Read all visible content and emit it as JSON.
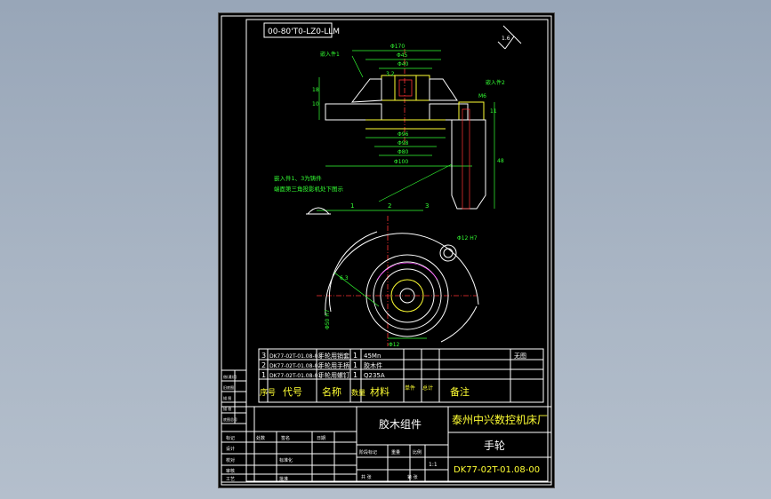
{
  "drawing_number_top": "00-80'T0-LZ0-LLM",
  "company": "泰州中兴数控机床厂",
  "assembly_name": "胶木组件",
  "part_name": "手轮",
  "drawing_number": "DK77-02T-01.08-00",
  "bom_header": {
    "no": "序号",
    "code": "代号",
    "name": "名称",
    "qty": "数量",
    "material": "材料",
    "unit_weight": "单件",
    "total_weight": "总计",
    "remark": "备注"
  },
  "bom_rows": [
    {
      "no": "3",
      "code": "DK77-02T-01.08-03",
      "name": "手轮用销套",
      "qty": "1",
      "material": "45Mn",
      "remark": "无图"
    },
    {
      "no": "2",
      "code": "DK77-02T-01.08-02",
      "name": "手轮用手柄",
      "qty": "1",
      "material": "胶木件",
      "remark": ""
    },
    {
      "no": "1",
      "code": "DK77-02T-01.08-01",
      "name": "手轮用螺钉",
      "qty": "1",
      "material": "Q235A",
      "remark": ""
    }
  ],
  "notes": {
    "line1": "嵌入件1、3为铸件",
    "line2": "端面第三角投影机处下图示",
    "insert_label_1": "嵌入件1",
    "insert_label_2": "嵌入件2"
  },
  "dimensions": {
    "d_outer": "Φ170",
    "d_45": "Φ45",
    "d_32": "3.2",
    "d_40": "Φ40",
    "d_96": "Φ96",
    "d_98": "Φ98",
    "d_100": "Φ100",
    "d_80": "Φ80",
    "h_18": "18",
    "h_10": "10",
    "h_48": "48",
    "h_11": "11",
    "thread": "M6",
    "roughness": "6.3",
    "angle": "1.6",
    "bottom_a": "Φ12",
    "bottom_b": "Φ12 H7",
    "side_dim": "Φ50 H7",
    "callout_3": "3",
    "callout_2": "2",
    "callout_1": "1"
  },
  "title_block_labels": {
    "designer": "设计",
    "checker": "校对",
    "standard": "标准化",
    "approver": "审核",
    "craft": "工艺",
    "approve": "批准",
    "mark": "标记",
    "count": "处数",
    "sign": "签名",
    "date": "日期",
    "stage": "阶段标记",
    "weight": "重量",
    "scale": "比例",
    "sheet": "共 张",
    "page": "第 张",
    "scale_value": "1:1",
    "side_1": "借(通)用",
    "side_2": "旧底图",
    "side_3": "描 图",
    "side_4": "描 校",
    "side_5": "底图总号",
    "side_6": "签字",
    "side_7": "日期"
  }
}
